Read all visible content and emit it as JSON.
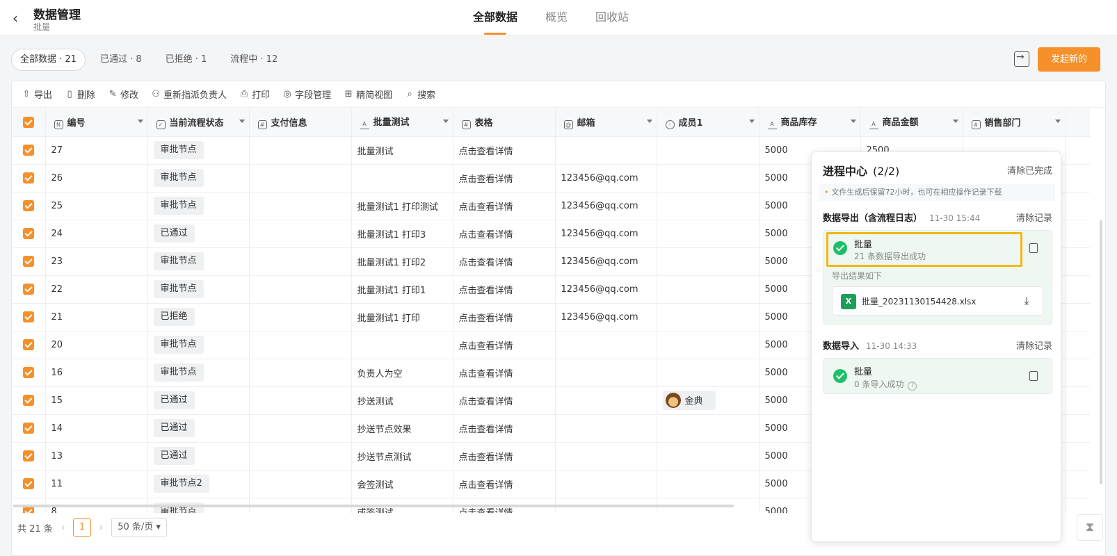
{
  "header": {
    "back_icon": "chevron-left-icon",
    "title": "数据管理",
    "subtitle": "批量",
    "tabs": [
      {
        "label": "全部数据",
        "active": true
      },
      {
        "label": "概览",
        "active": false
      },
      {
        "label": "回收站",
        "active": false
      }
    ]
  },
  "filters": [
    {
      "label": "全部数据 · 21",
      "active": true
    },
    {
      "label": "已通过 · 8",
      "active": false
    },
    {
      "label": "已拒绝 · 1",
      "active": false
    },
    {
      "label": "流程中 · 12",
      "active": false
    }
  ],
  "actions": {
    "new_button": "发起新的"
  },
  "toolbar": [
    {
      "label": "导出",
      "icon": "export-icon"
    },
    {
      "label": "删除",
      "icon": "trash-icon"
    },
    {
      "label": "修改",
      "icon": "edit-icon"
    },
    {
      "label": "重新指派负责人",
      "icon": "user-icon"
    },
    {
      "label": "打印",
      "icon": "printer-icon"
    },
    {
      "label": "字段管理",
      "icon": "settings-icon"
    },
    {
      "label": "精简视图",
      "icon": "grid-icon"
    },
    {
      "label": "搜索",
      "icon": "search-icon"
    }
  ],
  "table": {
    "columns": [
      {
        "label": "编号",
        "icon": "number-icon"
      },
      {
        "label": "当前流程状态",
        "icon": "check-square-icon"
      },
      {
        "label": "支付信息",
        "icon": "table-icon"
      },
      {
        "label": "批量测试",
        "icon": "text-icon"
      },
      {
        "label": "表格",
        "icon": "table-icon"
      },
      {
        "label": "邮箱",
        "icon": "mail-icon"
      },
      {
        "label": "成员1",
        "icon": "user-icon"
      },
      {
        "label": "商品库存",
        "icon": "text-icon"
      },
      {
        "label": "商品金额",
        "icon": "text-icon"
      },
      {
        "label": "销售部门",
        "icon": "org-icon"
      }
    ],
    "rows": [
      {
        "id": "27",
        "status": "审批节点",
        "pay": "",
        "batch": "批量测试",
        "table": "点击查看详情",
        "email": "",
        "member": "",
        "stock": "5000",
        "amount": "2500",
        "dept": ""
      },
      {
        "id": "26",
        "status": "审批节点",
        "pay": "",
        "batch": "",
        "table": "点击查看详情",
        "email": "123456@qq.com",
        "member": "",
        "stock": "5000",
        "amount": "",
        "dept": ""
      },
      {
        "id": "25",
        "status": "审批节点",
        "pay": "",
        "batch": "批量测试1 打印测试",
        "table": "点击查看详情",
        "email": "123456@qq.com",
        "member": "",
        "stock": "5000",
        "amount": "",
        "dept": ""
      },
      {
        "id": "24",
        "status": "已通过",
        "pay": "",
        "batch": "批量测试1 打印3",
        "table": "点击查看详情",
        "email": "123456@qq.com",
        "member": "",
        "stock": "5000",
        "amount": "",
        "dept": ""
      },
      {
        "id": "23",
        "status": "审批节点",
        "pay": "",
        "batch": "批量测试1 打印2",
        "table": "点击查看详情",
        "email": "123456@qq.com",
        "member": "",
        "stock": "5000",
        "amount": "",
        "dept": ""
      },
      {
        "id": "22",
        "status": "审批节点",
        "pay": "",
        "batch": "批量测试1 打印1",
        "table": "点击查看详情",
        "email": "123456@qq.com",
        "member": "",
        "stock": "5000",
        "amount": "",
        "dept": ""
      },
      {
        "id": "21",
        "status": "已拒绝",
        "pay": "",
        "batch": "批量测试1 打印",
        "table": "点击查看详情",
        "email": "123456@qq.com",
        "member": "",
        "stock": "5000",
        "amount": "",
        "dept": ""
      },
      {
        "id": "20",
        "status": "审批节点",
        "pay": "",
        "batch": "",
        "table": "点击查看详情",
        "email": "",
        "member": "",
        "stock": "5000",
        "amount": "",
        "dept": ""
      },
      {
        "id": "16",
        "status": "审批节点",
        "pay": "",
        "batch": "负责人为空",
        "table": "点击查看详情",
        "email": "",
        "member": "",
        "stock": "5000",
        "amount": "",
        "dept": ""
      },
      {
        "id": "15",
        "status": "已通过",
        "pay": "",
        "batch": "抄送测试",
        "table": "点击查看详情",
        "email": "",
        "member": "金典",
        "stock": "5000",
        "amount": "",
        "dept": ""
      },
      {
        "id": "14",
        "status": "已通过",
        "pay": "",
        "batch": "抄送节点效果",
        "table": "点击查看详情",
        "email": "",
        "member": "",
        "stock": "5000",
        "amount": "",
        "dept": ""
      },
      {
        "id": "13",
        "status": "已通过",
        "pay": "",
        "batch": "抄送节点测试",
        "table": "点击查看详情",
        "email": "",
        "member": "",
        "stock": "5000",
        "amount": "",
        "dept": ""
      },
      {
        "id": "11",
        "status": "审批节点2",
        "pay": "",
        "batch": "会签测试",
        "table": "点击查看详情",
        "email": "",
        "member": "",
        "stock": "5000",
        "amount": "",
        "dept": ""
      },
      {
        "id": "8",
        "status": "审批节点",
        "pay": "",
        "batch": "或签测试",
        "table": "点击查看详情",
        "email": "",
        "member": "",
        "stock": "5000",
        "amount": "",
        "dept": ""
      }
    ]
  },
  "pagination": {
    "total": "共 21 条",
    "page": "1",
    "page_size": "50 条/页"
  },
  "process_center": {
    "title": "进程中心",
    "count": "(2/2)",
    "clear_all": "清除已完成",
    "note": "文件生成后保留72小时，也可在相应操作记录下载",
    "export": {
      "heading": "数据导出（含流程日志）",
      "time": "11-30 15:44",
      "clear": "清除记录",
      "name": "批量",
      "desc": "21 条数据导出成功",
      "result_label": "导出结果如下",
      "file_name": "批量_20231130154428.xlsx"
    },
    "import": {
      "heading": "数据导入",
      "time": "11-30 14:33",
      "clear": "清除记录",
      "name": "批量",
      "desc": "0 条导入成功"
    }
  },
  "colors": {
    "accent": "#f5902a",
    "success": "#1fbf66",
    "highlight": "#f5b70f"
  }
}
